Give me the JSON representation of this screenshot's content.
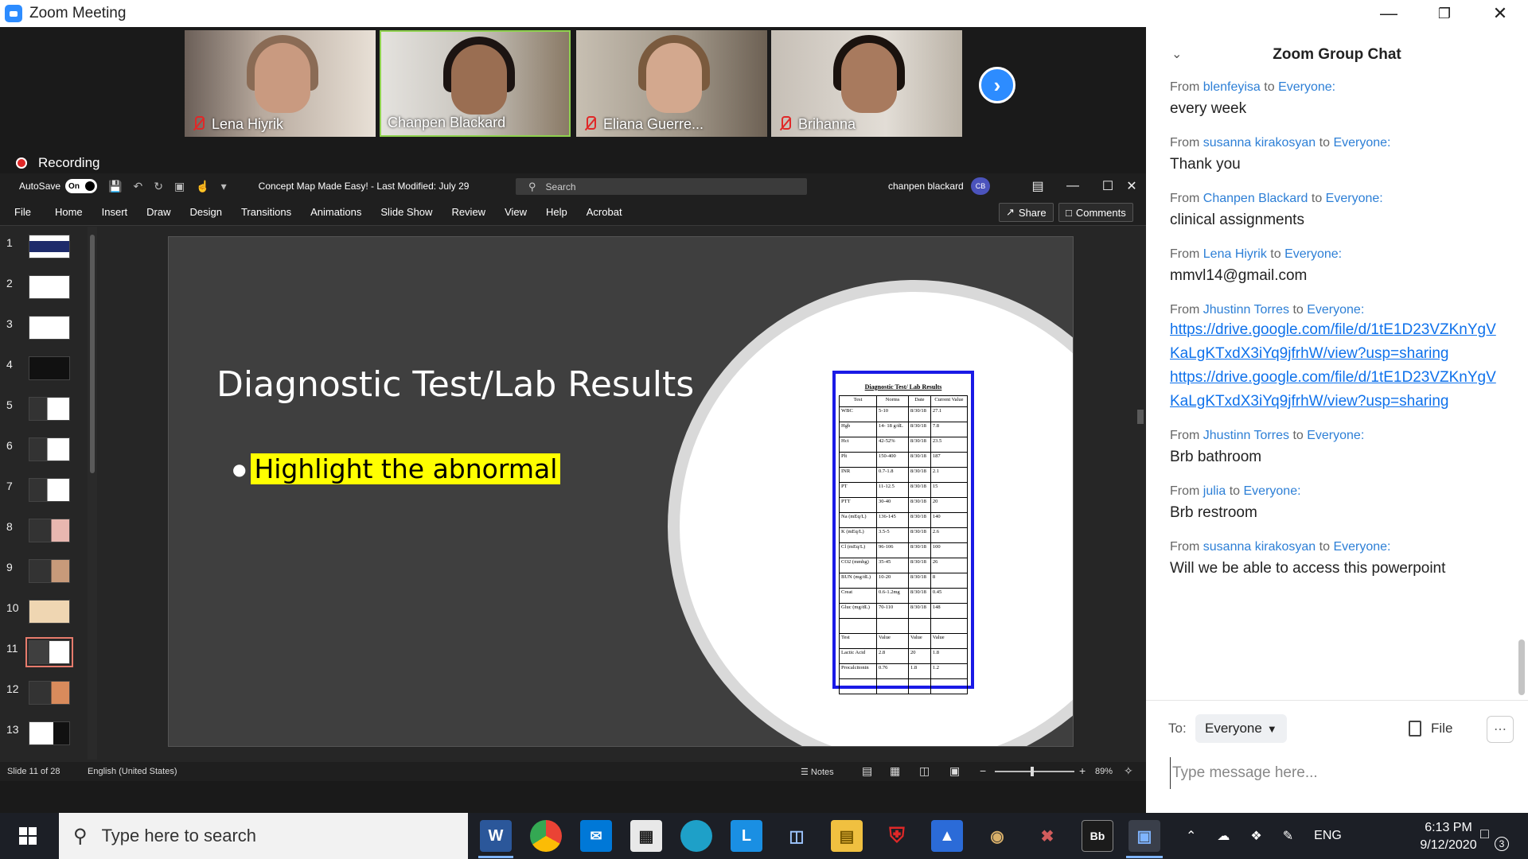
{
  "zoom": {
    "title": "Zoom Meeting",
    "participants": [
      {
        "name": "Lena Hiyrik",
        "muted": true
      },
      {
        "name": "Chanpen Blackard",
        "muted": false,
        "speaking": true
      },
      {
        "name": "Eliana Guerre...",
        "muted": true
      },
      {
        "name": "Brihanna",
        "muted": true
      }
    ],
    "recording_label": "Recording"
  },
  "ppt": {
    "autosave_label": "AutoSave",
    "autosave_state": "On",
    "doc_title": "Concept Map Made Easy!  -  Last Modified: July 29",
    "search_placeholder": "Search",
    "user_name": "chanpen blackard",
    "user_initials": "CB",
    "tabs": [
      "File",
      "Home",
      "Insert",
      "Draw",
      "Design",
      "Transitions",
      "Animations",
      "Slide Show",
      "Review",
      "View",
      "Help",
      "Acrobat"
    ],
    "share_label": "Share",
    "comments_label": "Comments",
    "thumbnails": [
      "1",
      "2",
      "3",
      "4",
      "5",
      "6",
      "7",
      "8",
      "9",
      "10",
      "11",
      "12",
      "13"
    ],
    "selected_slide": 11,
    "slide": {
      "title": "Diagnostic Test/Lab Results",
      "bullet": "Highlight the abnormal",
      "lab_doc": {
        "title": "Diagnostic Test/ Lab Results",
        "headers": [
          "Test",
          "Norms",
          "Date",
          "Current Value"
        ],
        "rows": [
          [
            "WBC",
            "5-10",
            "8/30/18",
            "27.1"
          ],
          [
            "Hgb",
            "14- 18 g/dL",
            "8/30/18",
            "7.8"
          ],
          [
            "Hct",
            "42-52%",
            "8/30/18",
            "23.5"
          ],
          [
            "Plt",
            "150-400",
            "8/30/18",
            "187"
          ],
          [
            "INR",
            "0.7-1.8",
            "8/30/18",
            "2.1"
          ],
          [
            "PT",
            "11-12.5",
            "8/30/18",
            "15"
          ],
          [
            "PTT",
            "30-40",
            "8/30/18",
            "20"
          ],
          [
            "Na (mEq/L)",
            "136-145",
            "8/30/18",
            "140"
          ],
          [
            "K (mEq/L)",
            "3.5-5",
            "8/30/18",
            "2.6"
          ],
          [
            "Cl (mEq/L)",
            "96-106",
            "8/30/18",
            "100"
          ],
          [
            "CO2 (mmhg)",
            "35-45",
            "8/30/18",
            "26"
          ],
          [
            "BUN (mg/dL)",
            "10-20",
            "8/30/18",
            "8"
          ],
          [
            "Creat",
            "0.6-1.2mg",
            "8/30/18",
            "0.45"
          ],
          [
            "Gluc (mg/dL)",
            "70-110",
            "8/30/18",
            "148"
          ],
          [
            "",
            "",
            "",
            ""
          ]
        ],
        "headers2": [
          "Test",
          "Value",
          "Value",
          "Value"
        ],
        "rows2": [
          [
            "Lactic Acid",
            "2.8",
            "20",
            "1.8"
          ],
          [
            "Procalcitonin",
            "0.76",
            "1.8",
            "1.2"
          ],
          [
            "",
            "",
            "",
            ""
          ]
        ]
      }
    },
    "status": {
      "slide_count": "Slide 11 of 28",
      "language": "English (United States)",
      "notes_label": "Notes",
      "zoom_level": "89%"
    }
  },
  "chat": {
    "title": "Zoom Group Chat",
    "messages": [
      {
        "from": "blenfeyisa",
        "to": "Everyone:",
        "text": "every week"
      },
      {
        "from": "susanna kirakosyan",
        "to": "Everyone:",
        "text": "Thank you"
      },
      {
        "from": "Chanpen Blackard",
        "to": "Everyone:",
        "text": "clinical assignments"
      },
      {
        "from": "Lena Hiyrik",
        "to": "Everyone:",
        "text": "mmvl14@gmail.com"
      },
      {
        "from": "Jhustinn Torres",
        "to": "Everyone:",
        "links": [
          "https://drive.google.com/file/d/1tE1D23VZKnYgVKaLgKTxdX3iYq9jfrhW/view?usp=sharing",
          "https://drive.google.com/file/d/1tE1D23VZKnYgVKaLgKTxdX3iYq9jfrhW/view?usp=sharing"
        ]
      },
      {
        "from": "Jhustinn Torres",
        "to": "Everyone:",
        "text": "Brb bathroom"
      },
      {
        "from": "julia",
        "to": "Everyone:",
        "text": "Brb restroom"
      },
      {
        "from": "susanna kirakosyan",
        "to": "Everyone:",
        "text": "Will we be able to access this powerpoint"
      }
    ],
    "from_prefix": "From",
    "to_word": "to",
    "to_label": "To:",
    "to_value": "Everyone",
    "file_label": "File",
    "input_placeholder": "Type message here..."
  },
  "taskbar": {
    "search_placeholder": "Type here to search",
    "lang": "ENG",
    "time": "6:13 PM",
    "date": "9/12/2020",
    "notifications": "3"
  }
}
